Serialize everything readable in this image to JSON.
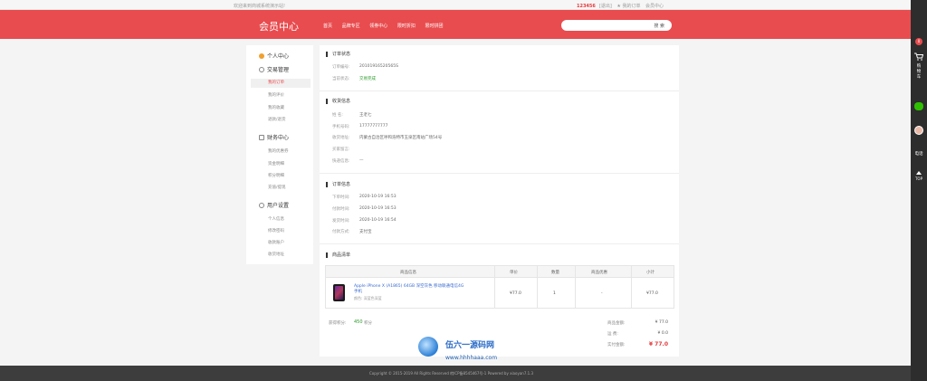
{
  "topbar": {
    "welcome": "欢迎来到商城系统演示站!",
    "username": "123456",
    "logout": "[退出]",
    "my_orders": "★ 我的订单",
    "member_center": "会员中心"
  },
  "header": {
    "logo": "会员中心",
    "nav": [
      "首页",
      "品牌专区",
      "领券中心",
      "限时折扣",
      "限时拼团"
    ],
    "search_button": "搜 索"
  },
  "sidebar": {
    "groups": [
      {
        "title": "个人中心"
      },
      {
        "title": "交易管理",
        "items": [
          "我的订单",
          "我的评价",
          "我的收藏",
          "退款/退货"
        ]
      },
      {
        "title": "财务中心",
        "items": [
          "我的优惠券",
          "资金明细",
          "积分明细",
          "充值/提现"
        ]
      },
      {
        "title": "用户设置",
        "items": [
          "个人信息",
          "修改密码",
          "收款账户",
          "收货地址"
        ]
      }
    ]
  },
  "order_status": {
    "title": "订单状态",
    "order_no_label": "订单编号:",
    "order_no": "20101916520565S",
    "status_label": "当前状态:",
    "status": "交易完成"
  },
  "receiver": {
    "title": "收货信息",
    "name_label": "姓    名:",
    "name": "王老七",
    "phone_label": "手机号码:",
    "phone": "17777777777",
    "address_label": "收货地址:",
    "address": "内蒙古自治区呼和浩特市玉泉区南站广场54号",
    "note_label": "买家留言:",
    "note": "",
    "express_label": "快递信息:",
    "express": "—"
  },
  "order_info": {
    "title": "订单信息",
    "create_label": "下单时间:",
    "create_time": "2020-10-19 16:53",
    "pay_label": "付款时间:",
    "pay_time": "2020-10-19 16:53",
    "ship_label": "发货时间:",
    "ship_time": "2020-10-19 16:54",
    "method_label": "付款方式:",
    "method": "支付宝"
  },
  "goods": {
    "title": "商品清单",
    "columns": [
      "商品信息",
      "单价",
      "数量",
      "商品优惠",
      "小计"
    ],
    "item": {
      "name": "Apple iPhone X (A1865) 64GB 深空灰色 移动联通电信4G手机",
      "attr": "颜色: 深蓝色深蓝",
      "price": "¥77.0",
      "qty": "1",
      "discount": "-",
      "subtotal": "¥77.0"
    }
  },
  "summary": {
    "points_label": "获得积分:",
    "points": "450",
    "points_unit": "积分",
    "goods_amount_label": "商品金额:",
    "goods_amount": "¥ 77.0",
    "freight_label": "运    费:",
    "freight": "¥ 0.0",
    "paid_label": "实付金额:",
    "paid": "¥ 77.0"
  },
  "watermark": {
    "text": "伍六一源码网",
    "url": "www.hhhhaaa.com"
  },
  "footer": {
    "copyright": "Copyright © 2015-2019 All Rights Reserved 皖ICP备8545467号-1   Powered by xiaoyan7.1.3"
  },
  "rightbar": {
    "cart_count": "0",
    "cart_label": "购物车",
    "phone_label": "电话",
    "top_label": "TOP"
  },
  "colors": {
    "brand": "#e84c4f",
    "status_green": "#2a9b2a",
    "price_red": "#e4393c"
  }
}
